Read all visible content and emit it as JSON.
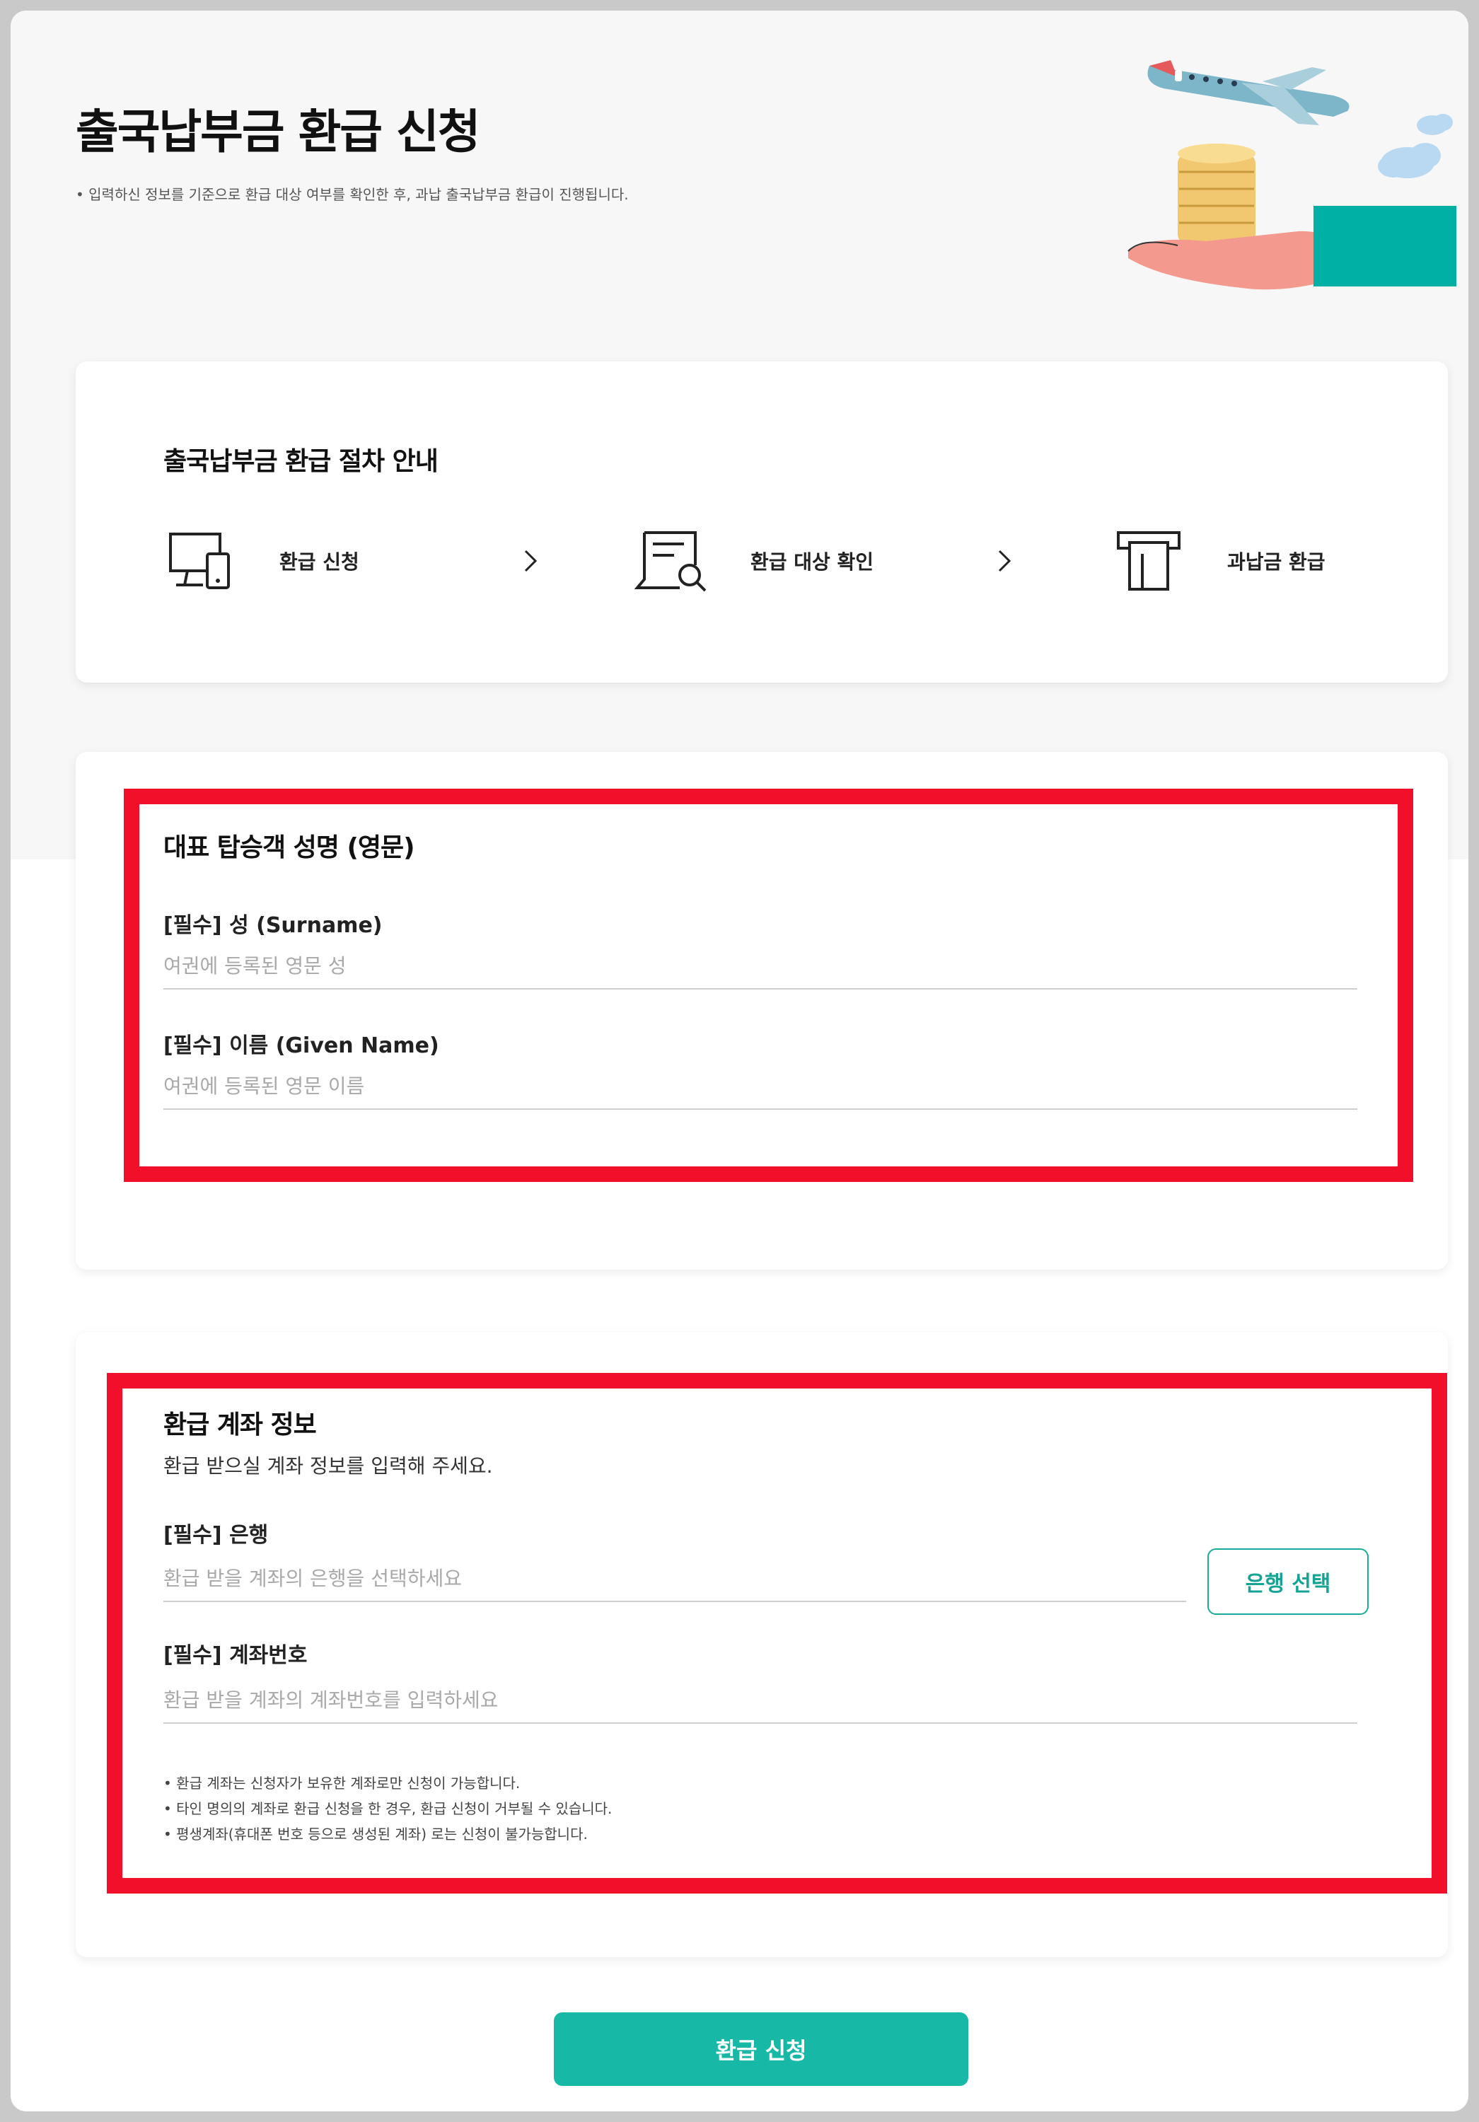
{
  "header": {
    "title": "출국납부금 환급 신청",
    "description": "입력하신 정보를 기준으로 환급 대상 여부를 확인한 후, 과납 출국납부금 환급이 진행됩니다."
  },
  "procedure": {
    "title": "출국납부금 환급 절차 안내",
    "steps": [
      {
        "label": "환급 신청",
        "icon": "devices-icon"
      },
      {
        "label": "환급 대상 확인",
        "icon": "document-search-icon"
      },
      {
        "label": "과납금 환급",
        "icon": "atm-cash-icon"
      }
    ]
  },
  "passenger": {
    "title": "대표 탑승객 성명 (영문)",
    "surname_label": "[필수] 성 (Surname)",
    "surname_placeholder": "여권에 등록된 영문 성",
    "surname_value": "",
    "given_label": "[필수] 이름 (Given Name)",
    "given_placeholder": "여권에 등록된 영문 이름",
    "given_value": ""
  },
  "account": {
    "title": "환급 계좌 정보",
    "subtitle": "환급 받으실 계좌 정보를 입력해 주세요.",
    "bank_label": "[필수] 은행",
    "bank_placeholder": "환급 받을 계좌의 은행을 선택하세요",
    "bank_value": "",
    "bank_button": "은행 선택",
    "number_label": "[필수] 계좌번호",
    "number_placeholder": "환급 받을 계좌의 계좌번호를 입력하세요",
    "number_value": "",
    "notes": [
      "환급 계좌는 신청자가 보유한 계좌로만 신청이 가능합니다.",
      "타인 명의의 계좌로 환급 신청을 한 경우, 환급 신청이 거부될 수 있습니다.",
      "평생계좌(휴대폰 번호 등으로 생성된 계좌) 로는 신청이 불가능합니다."
    ]
  },
  "submit": {
    "label": "환급 신청"
  },
  "colors": {
    "accent": "#17b9a6",
    "highlight": "#f20f2a"
  }
}
